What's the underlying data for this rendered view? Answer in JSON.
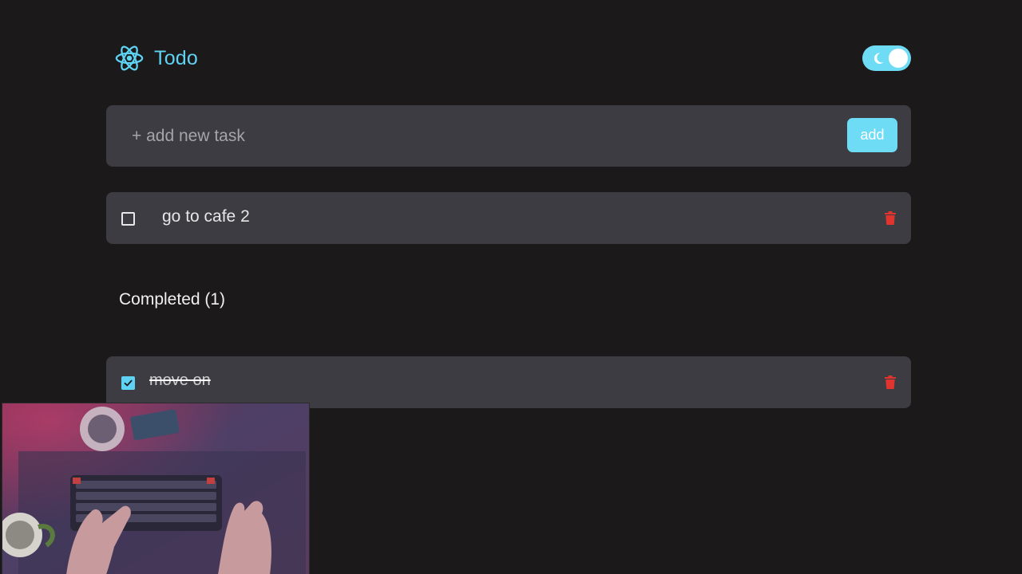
{
  "header": {
    "title": "Todo",
    "logo_icon": "react-atom-icon",
    "theme_toggle": {
      "icon": "moon-icon",
      "state": "dark"
    }
  },
  "add_task": {
    "placeholder": "+ add new task",
    "value": "",
    "button_label": "add"
  },
  "tasks": [
    {
      "label": "go to cafe 2",
      "completed": false
    }
  ],
  "completed_section": {
    "heading": "Completed (1)",
    "tasks": [
      {
        "label": "move on",
        "completed": true
      }
    ]
  },
  "colors": {
    "accent": "#6fdcf6",
    "background": "#1b1919",
    "card": "#3e3c43",
    "delete": "#e0342f"
  },
  "webcam_overlay": {
    "description_icon": "webcam-feed-icon"
  }
}
